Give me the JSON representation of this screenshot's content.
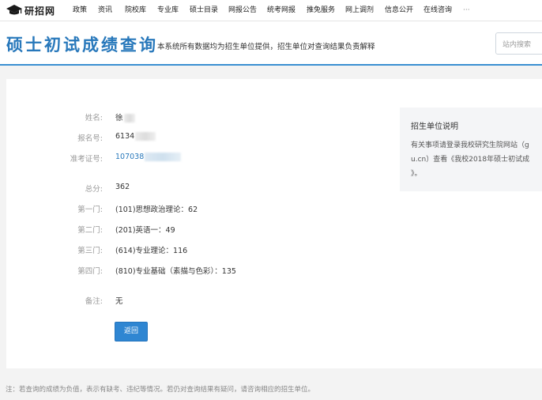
{
  "nav": {
    "logo_text": "研招网",
    "items": [
      "政策",
      "资讯",
      "院校库",
      "专业库",
      "硕士目录",
      "网报公告",
      "统考网报",
      "推免服务",
      "网上调剂",
      "信息公开",
      "在线咨询",
      "···"
    ]
  },
  "header": {
    "title": "硕士初试成绩查询",
    "subtitle": "本系统所有数据均为招生单位提供，招生单位对查询结果负责解释",
    "search_placeholder": "站内搜索"
  },
  "result": {
    "name": {
      "label": "姓名:",
      "value": "徐"
    },
    "reg_no": {
      "label": "报名号:",
      "value": "6134"
    },
    "exam_no": {
      "label": "准考证号:",
      "value": "107038"
    },
    "total": {
      "label": "总分:",
      "value": "362"
    },
    "subject1": {
      "label": "第一门:",
      "value": "(101)思想政治理论：62"
    },
    "subject2": {
      "label": "第二门:",
      "value": "(201)英语一：49"
    },
    "subject3": {
      "label": "第三门:",
      "value": "(614)专业理论：116"
    },
    "subject4": {
      "label": "第四门:",
      "value": "(810)专业基础（素描与色彩）：135"
    },
    "remark": {
      "label": "备注:",
      "value": "无"
    },
    "back_label": "返回"
  },
  "side": {
    "title": "招生单位说明",
    "line1": "有关事项请登录我校研究生院网站（g",
    "line2": "u.cn）查看《我校2018年硕士初试成",
    "line3": "》。"
  },
  "footer_note": "注：若查询的成绩为负值，表示有缺考、违纪等情况。若仍对查询结果有疑问，请咨询相应的招生单位。"
}
